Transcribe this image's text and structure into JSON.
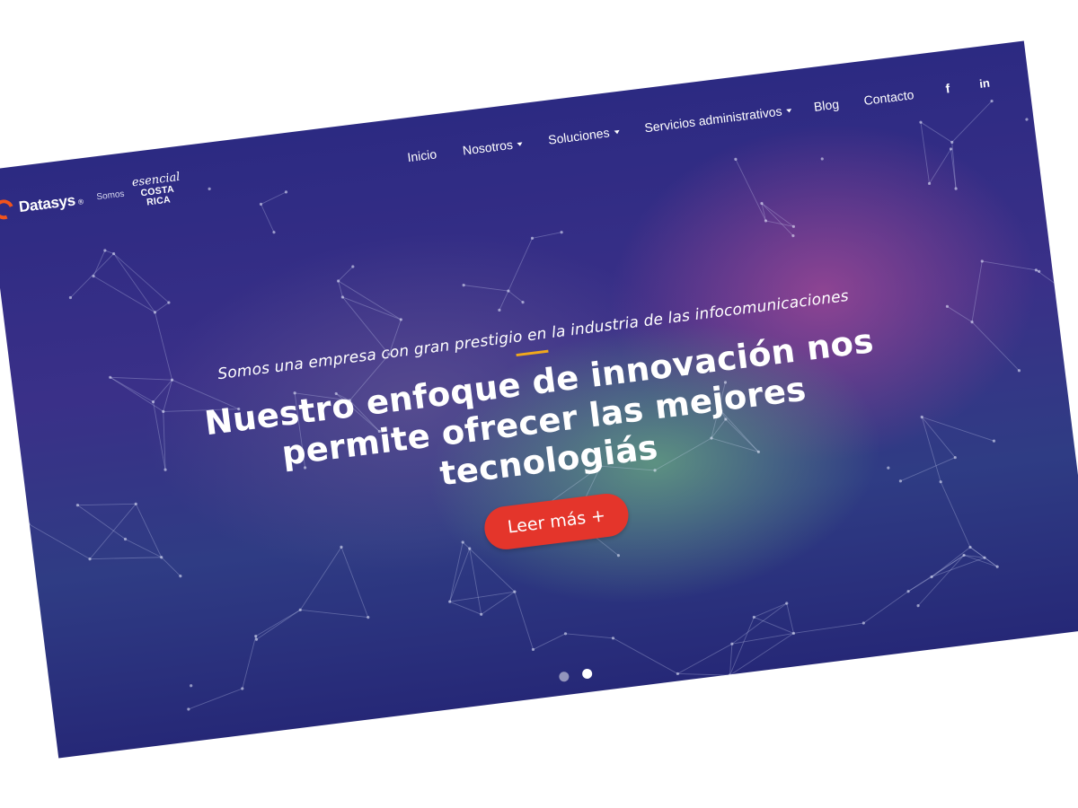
{
  "brand": {
    "logo_text": "Datasys",
    "logo_reg": "®",
    "somos": "Somos",
    "esencial_script": "esencial",
    "esencial_line1": "COSTA",
    "esencial_line2": "RICA",
    "esencial_reg": "®",
    "accent_color": "#f0531c"
  },
  "nav": {
    "items": [
      {
        "label": "Inicio",
        "has_dropdown": false
      },
      {
        "label": "Nosotros",
        "has_dropdown": true
      },
      {
        "label": "Soluciones",
        "has_dropdown": true
      },
      {
        "label": "Servicios administrativos",
        "has_dropdown": true
      },
      {
        "label": "Blog",
        "has_dropdown": false
      },
      {
        "label": "Contacto",
        "has_dropdown": false
      }
    ],
    "social": [
      {
        "icon": "facebook-icon",
        "glyph": "f"
      },
      {
        "icon": "linkedin-icon",
        "glyph": "in"
      }
    ]
  },
  "hero": {
    "tagline": "Somos una empresa con gran prestigio en la industria de las infocomunicaciones",
    "title_line1": "Nuestro enfoque de innovación nos",
    "title_line2": "permite ofrecer las mejores tecnologiás",
    "button_label": "Leer más +",
    "button_color": "#e4352b",
    "underline_color": "#f0a81c"
  },
  "slider": {
    "total_slides": 2,
    "active_slide": 2
  }
}
